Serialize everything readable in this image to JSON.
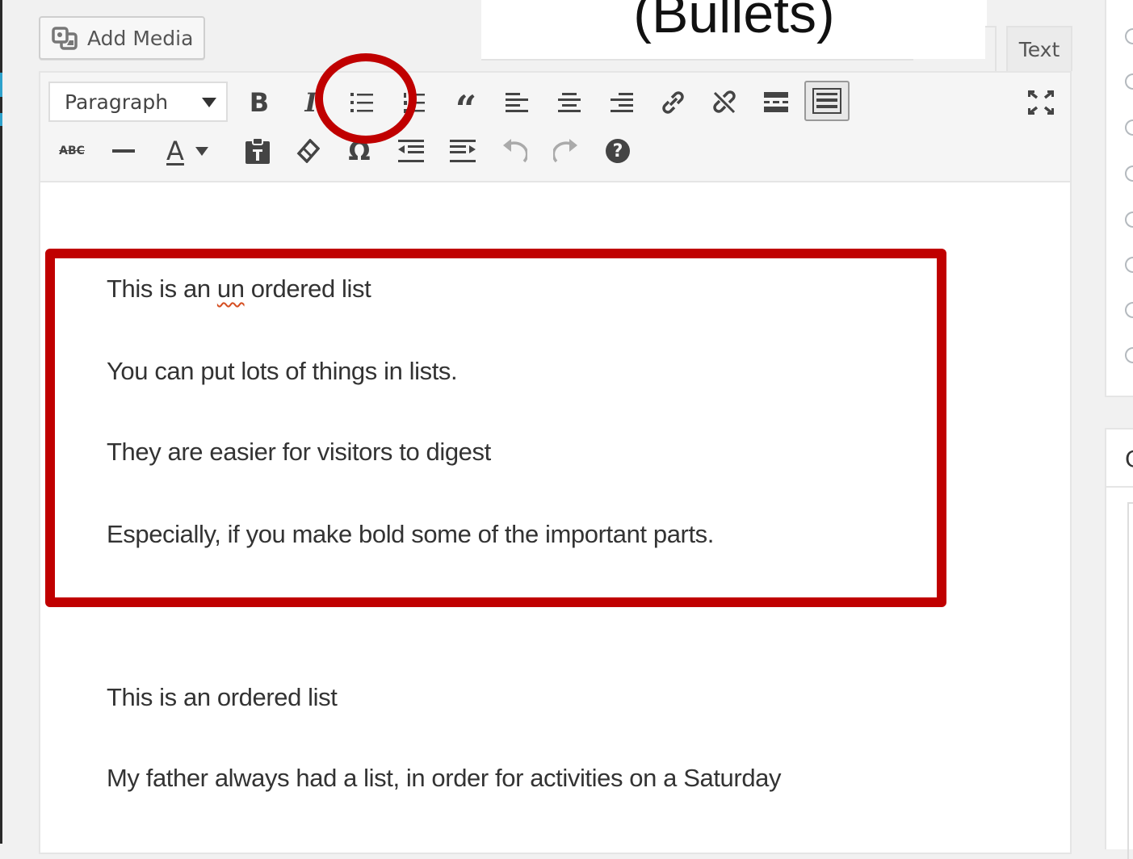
{
  "add_media": {
    "label": "Add Media",
    "icon": "media-icon"
  },
  "title_overlay": "(Bullets)",
  "tabs": {
    "text_label": "Text"
  },
  "toolbar": {
    "format_value": "Paragraph",
    "row1": [
      "bold-icon",
      "italic-icon",
      "bulleted-list-icon",
      "numbered-list-icon",
      "blockquote-icon",
      "align-left-icon",
      "align-center-icon",
      "align-right-icon",
      "insert-link-icon",
      "remove-link-icon",
      "read-more-icon",
      "toolbar-toggle-icon"
    ],
    "row2": [
      "strikethrough-icon",
      "horizontal-line-icon",
      "text-color-icon",
      "paste-text-icon",
      "clear-formatting-icon",
      "special-character-icon",
      "outdent-icon",
      "indent-icon",
      "undo-icon",
      "redo-icon",
      "help-icon"
    ],
    "bold_glyph": "B",
    "italic_glyph": "I",
    "strike_glyph": "ABC",
    "color_glyph": "A",
    "omega_glyph": "Ω",
    "help_glyph": "?",
    "quote_glyph": "“"
  },
  "content": {
    "para1_before": "This is an ",
    "para1_misspelled": "un",
    "para1_after": " ordered list",
    "para2": "You can put lots of things in lists.",
    "para3": "They are easier for visitors to digest",
    "para4": "Especially, if you make bold some of the important parts.",
    "para5": "This is an ordered list",
    "para6": "My father always had a list, in order for activities on a Saturday"
  },
  "sidebar": {
    "partial_heading": "C"
  },
  "colors": {
    "annotation_red": "#c00000",
    "text": "#333333",
    "toolbar_bg": "#f5f5f5"
  }
}
